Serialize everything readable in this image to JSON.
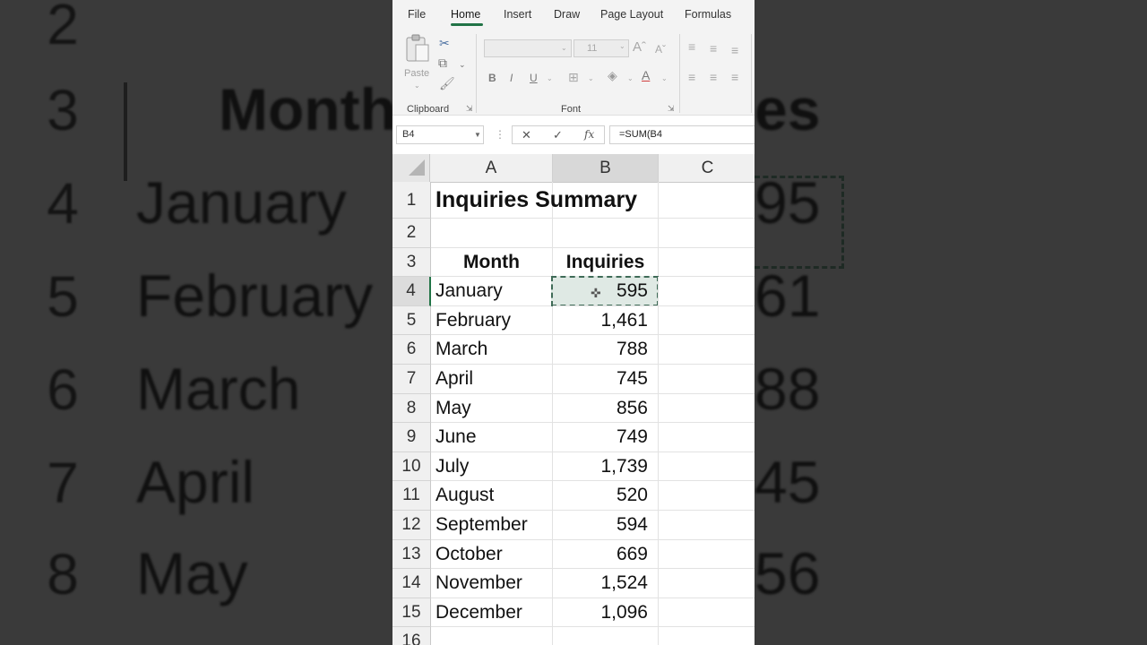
{
  "background": {
    "rows": [
      {
        "num": "2",
        "label": "",
        "value": ""
      },
      {
        "num": "3",
        "label": "Month",
        "value": "es"
      },
      {
        "num": "4",
        "label": "January",
        "value": "95"
      },
      {
        "num": "5",
        "label": "February",
        "value": "61"
      },
      {
        "num": "6",
        "label": "March",
        "value": "88"
      },
      {
        "num": "7",
        "label": "April",
        "value": "45"
      },
      {
        "num": "8",
        "label": "May",
        "value": "56"
      }
    ]
  },
  "ribbon": {
    "tabs": [
      "File",
      "Home",
      "Insert",
      "Draw",
      "Page Layout",
      "Formulas"
    ],
    "active_tab": "Home",
    "clipboard": {
      "label": "Clipboard",
      "paste_label": "Paste"
    },
    "font": {
      "label": "Font",
      "size": "11"
    }
  },
  "formula_bar": {
    "name_box": "B4",
    "formula": "=SUM(B4"
  },
  "sheet": {
    "columns": [
      "A",
      "B",
      "C"
    ],
    "title": "Inquiries Summary",
    "header": {
      "month": "Month",
      "inquiries": "Inquiries"
    },
    "row_numbers": [
      "1",
      "2",
      "3",
      "4",
      "5",
      "6",
      "7",
      "8",
      "9",
      "10",
      "11",
      "12",
      "13",
      "14",
      "15",
      "16"
    ],
    "data": [
      {
        "month": "January",
        "inquiries": "595"
      },
      {
        "month": "February",
        "inquiries": "1,461"
      },
      {
        "month": "March",
        "inquiries": "788"
      },
      {
        "month": "April",
        "inquiries": "745"
      },
      {
        "month": "May",
        "inquiries": "856"
      },
      {
        "month": "June",
        "inquiries": "749"
      },
      {
        "month": "July",
        "inquiries": "1,739"
      },
      {
        "month": "August",
        "inquiries": "520"
      },
      {
        "month": "September",
        "inquiries": "594"
      },
      {
        "month": "October",
        "inquiries": "669"
      },
      {
        "month": "November",
        "inquiries": "1,524"
      },
      {
        "month": "December",
        "inquiries": "1,096"
      }
    ]
  },
  "colors": {
    "accent": "#217346",
    "selection_fill": "#dfe9e4"
  }
}
